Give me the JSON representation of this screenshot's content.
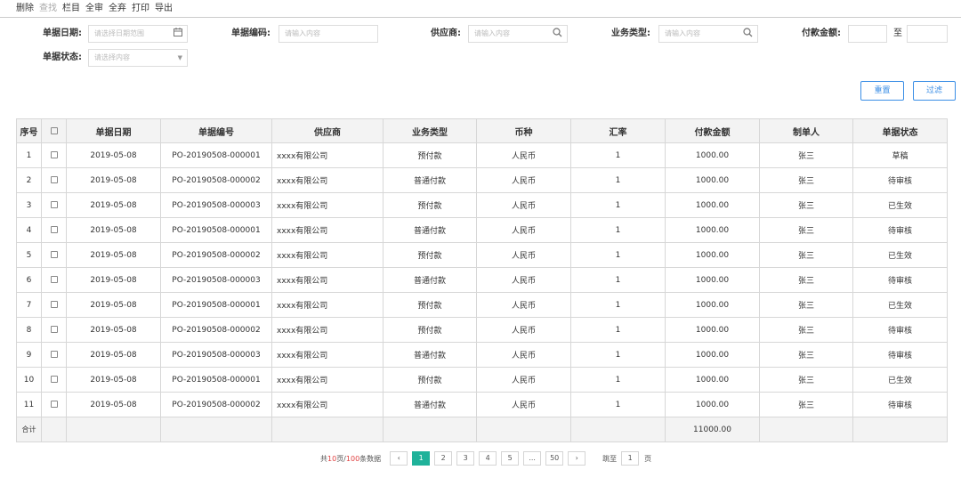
{
  "toolbar": {
    "delete": "删除",
    "view": "查找",
    "columns": "栏目",
    "approve_all": "全审",
    "abandon_all": "全弃",
    "print": "打印",
    "export": "导出"
  },
  "filters": {
    "date_label": "单据日期:",
    "date_placeholder": "请选择日期范围",
    "code_label": "单据编码:",
    "code_placeholder": "请输入内容",
    "supplier_label": "供应商:",
    "supplier_placeholder": "请输入内容",
    "biztype_label": "业务类型:",
    "biztype_placeholder": "请输入内容",
    "amount_label": "付款金额:",
    "amount_to": "至",
    "status_label": "单据状态:",
    "status_placeholder": "请选择内容"
  },
  "buttons": {
    "reset": "重置",
    "filter": "过滤"
  },
  "table": {
    "headers": [
      "序号",
      "",
      "单据日期",
      "单据编号",
      "供应商",
      "业务类型",
      "币种",
      "汇率",
      "付款金额",
      "制单人",
      "单据状态"
    ],
    "rows": [
      [
        "1",
        "2019-05-08",
        "PO-20190508-000001",
        "xxxx有限公司",
        "预付款",
        "人民币",
        "1",
        "1000.00",
        "张三",
        "草稿"
      ],
      [
        "2",
        "2019-05-08",
        "PO-20190508-000002",
        "xxxx有限公司",
        "普通付款",
        "人民币",
        "1",
        "1000.00",
        "张三",
        "待审核"
      ],
      [
        "3",
        "2019-05-08",
        "PO-20190508-000003",
        "xxxx有限公司",
        "预付款",
        "人民币",
        "1",
        "1000.00",
        "张三",
        "已生效"
      ],
      [
        "4",
        "2019-05-08",
        "PO-20190508-000001",
        "xxxx有限公司",
        "普通付款",
        "人民币",
        "1",
        "1000.00",
        "张三",
        "待审核"
      ],
      [
        "5",
        "2019-05-08",
        "PO-20190508-000002",
        "xxxx有限公司",
        "预付款",
        "人民币",
        "1",
        "1000.00",
        "张三",
        "已生效"
      ],
      [
        "6",
        "2019-05-08",
        "PO-20190508-000003",
        "xxxx有限公司",
        "普通付款",
        "人民币",
        "1",
        "1000.00",
        "张三",
        "待审核"
      ],
      [
        "7",
        "2019-05-08",
        "PO-20190508-000001",
        "xxxx有限公司",
        "预付款",
        "人民币",
        "1",
        "1000.00",
        "张三",
        "已生效"
      ],
      [
        "8",
        "2019-05-08",
        "PO-20190508-000002",
        "xxxx有限公司",
        "预付款",
        "人民币",
        "1",
        "1000.00",
        "张三",
        "待审核"
      ],
      [
        "9",
        "2019-05-08",
        "PO-20190508-000003",
        "xxxx有限公司",
        "普通付款",
        "人民币",
        "1",
        "1000.00",
        "张三",
        "待审核"
      ],
      [
        "10",
        "2019-05-08",
        "PO-20190508-000001",
        "xxxx有限公司",
        "预付款",
        "人民币",
        "1",
        "1000.00",
        "张三",
        "已生效"
      ],
      [
        "11",
        "2019-05-08",
        "PO-20190508-000002",
        "xxxx有限公司",
        "普通付款",
        "人民币",
        "1",
        "1000.00",
        "张三",
        "待审核"
      ]
    ],
    "total_label": "合计",
    "total_amount": "11000.00"
  },
  "pagination": {
    "summary_prefix": "共",
    "pages": "10",
    "summary_mid": "页/",
    "records": "100",
    "summary_suffix": "条数据",
    "prev": "‹",
    "next": "›",
    "page_buttons": [
      "1",
      "2",
      "3",
      "4",
      "5",
      "...",
      "50"
    ],
    "active_page": "1",
    "goto_label": "跳至",
    "goto_value": "1",
    "goto_suffix": "页"
  },
  "colors": {
    "accent": "#3a8ee6",
    "active_page": "#1fb29a",
    "header_bg": "#f3f3f3"
  },
  "icons": {
    "date": "calendar-icon",
    "search": "search-icon",
    "dropdown": "caret-down-icon"
  }
}
